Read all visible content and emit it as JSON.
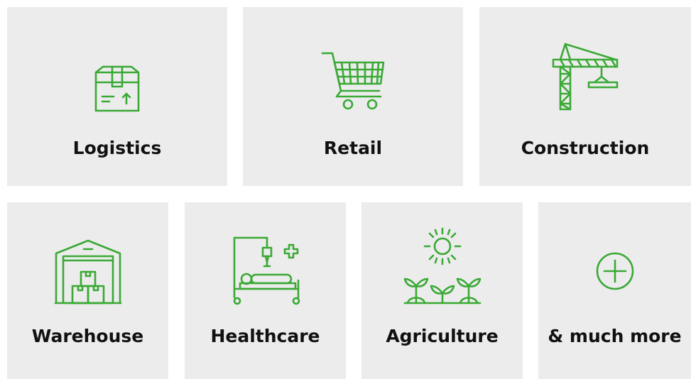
{
  "accent_color": "#3aa935",
  "tile_background": "#ececec",
  "tiles": [
    {
      "label": "Logistics",
      "icon": "package-box-icon"
    },
    {
      "label": "Retail",
      "icon": "shopping-cart-icon"
    },
    {
      "label": "Construction",
      "icon": "tower-crane-icon"
    },
    {
      "label": "Warehouse",
      "icon": "warehouse-icon"
    },
    {
      "label": "Healthcare",
      "icon": "hospital-bed-icon"
    },
    {
      "label": "Agriculture",
      "icon": "sun-and-plants-icon"
    },
    {
      "label": "& much more",
      "icon": "plus-circle-icon"
    }
  ]
}
